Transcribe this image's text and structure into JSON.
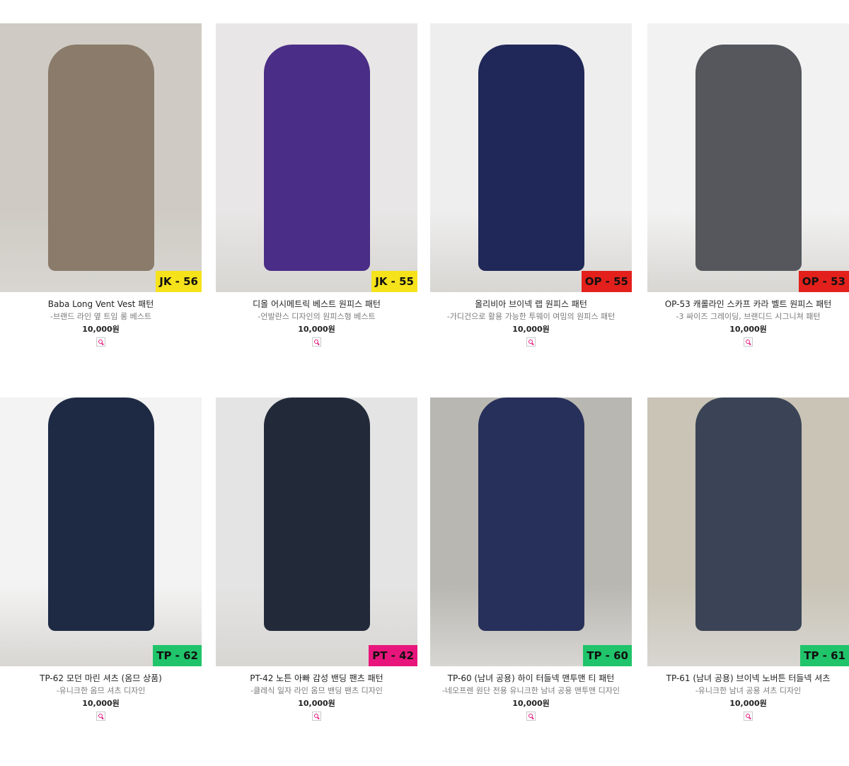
{
  "products": [
    {
      "name": "Baba Long Vent Vest 패턴",
      "desc": "-브랜드 라인 옆 트임 롱 베스트",
      "price": "10,000원",
      "badge": "JK - 56",
      "badge_color": "#f5e21b",
      "bg": "#cfcbc4",
      "garment": "#8a7b6a",
      "icon": "zoom-icon"
    },
    {
      "name": "디올 어시메트릭 베스트 원피스 패턴",
      "desc": "-언발란스 디자인의 원피스형 베스트",
      "price": "10,000원",
      "badge": "JK - 55",
      "badge_color": "#f5e21b",
      "bg": "#e8e6e6",
      "garment": "#4a2d86",
      "icon": "zoom-icon"
    },
    {
      "name": "올리비아 브이넥 랩 원피스 패턴",
      "desc": "-가디건으로 활용 가능한 투웨이 여밈의 원피스 패턴",
      "price": "10,000원",
      "badge": "OP - 55",
      "badge_color": "#e3201b",
      "bg": "#eeeeee",
      "garment": "#1f2858",
      "icon": "zoom-icon"
    },
    {
      "name": "OP-53 캐롤라인 스카프 카라 벨트 원피스 패턴",
      "desc": "-3 싸이즈 그레이딩, 브랜디드 시그니쳐 패턴",
      "price": "10,000원",
      "badge": "OP - 53",
      "badge_color": "#e3201b",
      "bg": "#f2f2f2",
      "garment": "#55575d",
      "icon": "zoom-icon"
    },
    {
      "name": "TP-62 모던 마린 셔츠 (옴므 상품)",
      "desc": "-유니크한 옴므 셔츠 디자인",
      "price": "10,000원",
      "badge": "TP - 62",
      "badge_color": "#20c46a",
      "bg": "#f3f3f3",
      "garment": "#1e2a44",
      "icon": "zoom-icon"
    },
    {
      "name": "PT-42 노튼 아빠 감성 밴딩 팬츠 패턴",
      "desc": "-클레식 일자 라인 옴므 밴딩 팬츠 디자인",
      "price": "10,000원",
      "badge": "PT - 42",
      "badge_color": "#e8167c",
      "bg": "#e4e4e4",
      "garment": "#222a3a",
      "icon": "zoom-icon"
    },
    {
      "name": "TP-60 (남녀 공용) 하이 터들넥 맨투맨 티 패턴",
      "desc": "-네오프렌 원단 전용 유니크한 남녀 공용 맨투맨 디자인",
      "price": "10,000원",
      "badge": "TP - 60",
      "badge_color": "#20c46a",
      "bg": "#b9b7b2",
      "garment": "#27305a",
      "icon": "zoom-icon"
    },
    {
      "name": "TP-61 (남녀 공용) 브이넥 노버튼 터들넥 셔츠",
      "desc": "-유니크한 남녀 공용 셔츠 디자인",
      "price": "10,000원",
      "badge": "TP - 61",
      "badge_color": "#20c46a",
      "bg": "#c9c4b6",
      "garment": "#3a4456",
      "icon": "zoom-icon"
    }
  ]
}
